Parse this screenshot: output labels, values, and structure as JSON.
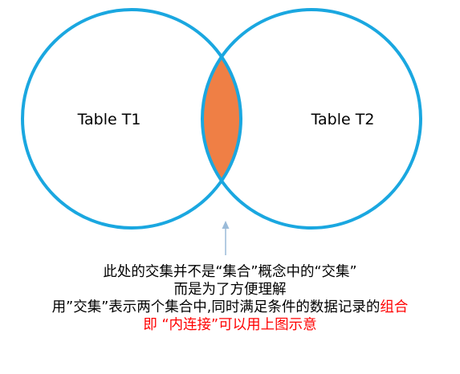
{
  "diagram": {
    "left_set_label": "Table T1",
    "right_set_label": "Table T2",
    "circle_color": "#1aa7e0",
    "intersection_color": "#ef7f45",
    "arrow_color": "#9bbbd9"
  },
  "caption": {
    "line1": "此处的交集并不是“集合”概念中的“交集”",
    "line2": "而是为了方便理解",
    "line3_black": "用”交集”表示两个集合中,同时满足条件的数据记录的",
    "line3_red": "组合",
    "line4": "即 “内连接”可以用上图示意",
    "highlight_color": "#ff0000"
  }
}
